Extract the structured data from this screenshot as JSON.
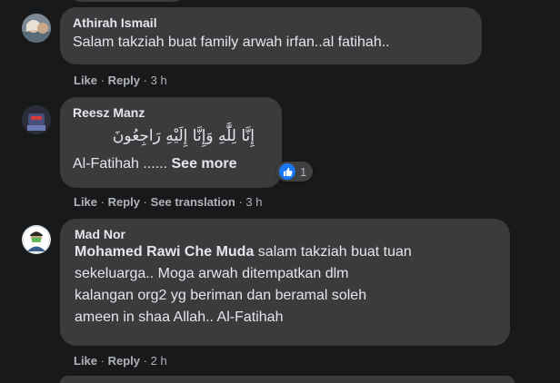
{
  "comments": [
    {
      "author": "Athirah Ismail",
      "text": "Salam takziah buat family arwah irfan..al fatihah..",
      "actions": {
        "like": "Like",
        "reply": "Reply",
        "time": "3 h"
      }
    },
    {
      "author": "Reesz Manz",
      "arabic": "إِنَّا لِلَّٰهِ وَإِنَّا إِلَيْهِ رَاجِعُونَ",
      "text": "Al-Fatihah ......",
      "see_more": "See more",
      "reaction_count": "1",
      "reaction_icon": "like-icon",
      "actions": {
        "like": "Like",
        "reply": "Reply",
        "see_translation": "See translation",
        "time": "3 h"
      }
    },
    {
      "author": "Mad Nor",
      "mention": "Mohamed Rawi Che Muda",
      "text_line1": " salam takziah buat tuan",
      "text_line2": "sekeluarga.. Moga arwah ditempatkan dlm",
      "text_line3": "kalangan org2 yg beriman dan beramal soleh",
      "text_line4": "ameen in shaa Allah.. Al-Fatihah",
      "actions": {
        "like": "Like",
        "reply": "Reply",
        "time": "2 h"
      }
    }
  ],
  "separator": "·",
  "colors": {
    "background": "#18191a",
    "bubble": "#3a3b3c",
    "secondary_text": "#b0b3b8",
    "like_blue": "#1877f2"
  }
}
